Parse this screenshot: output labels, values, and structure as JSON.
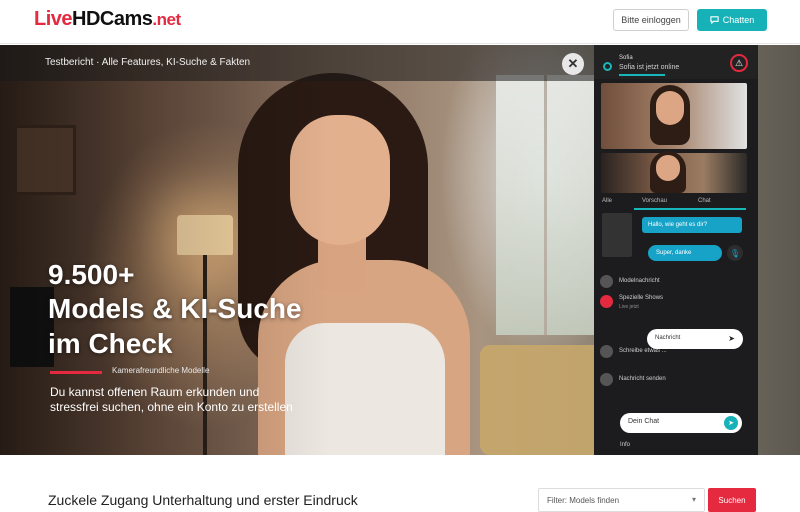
{
  "header": {
    "logo": {
      "part1": "Live",
      "part2": "HD",
      "part3": "Cams",
      "part4": ".net"
    },
    "login_label": "Bitte einloggen",
    "cta_label": "Chatten",
    "cta_icon": "chat-bubble-icon"
  },
  "hero": {
    "topbar_text": "Testbericht · Alle Features, KI-Suche & Fakten",
    "close_icon": "✕",
    "headline_count": "9.500+",
    "headline_line1": "Models & KI-Suche",
    "headline_line2": "im Check",
    "small_caption": "Kamerafreundliche Modelle",
    "description": "Du kannst offenen Raum erkunden und stressfrei suchen, ohne ein Konto zu erstellen"
  },
  "chat_panel": {
    "model_name": "Sofia",
    "model_status": "Sofia ist jetzt online",
    "warning_icon": "⚠",
    "tabs": [
      "Alle",
      "Vorschau",
      "Chat"
    ],
    "bubble1": "Hallo, wie geht es dir?",
    "bubble2": "Super, danke",
    "bubble_icon": "🎙",
    "rows": [
      {
        "title": "Modelnachricht",
        "sub": ""
      },
      {
        "title": "Spezielle Shows",
        "sub": "Live jetzt"
      },
      {
        "title": "Schreibe etwas ...",
        "sub": ""
      },
      {
        "title": "Nachricht senden",
        "sub": ""
      }
    ],
    "pill_label": "Nachricht",
    "pill_arrow": "➤",
    "input_value": "Dein Chat",
    "send_icon": "➤",
    "bottom_text": "Info"
  },
  "bottom": {
    "title": "Zuckele Zugang Unterhaltung und erster Eindruck",
    "select_value": "Filter: Models finden",
    "select_chevron": "▾",
    "button_label": "Suchen"
  },
  "colors": {
    "brand_red": "#e5293f",
    "teal": "#17b2b7",
    "bubble_blue": "#17a3c7"
  }
}
